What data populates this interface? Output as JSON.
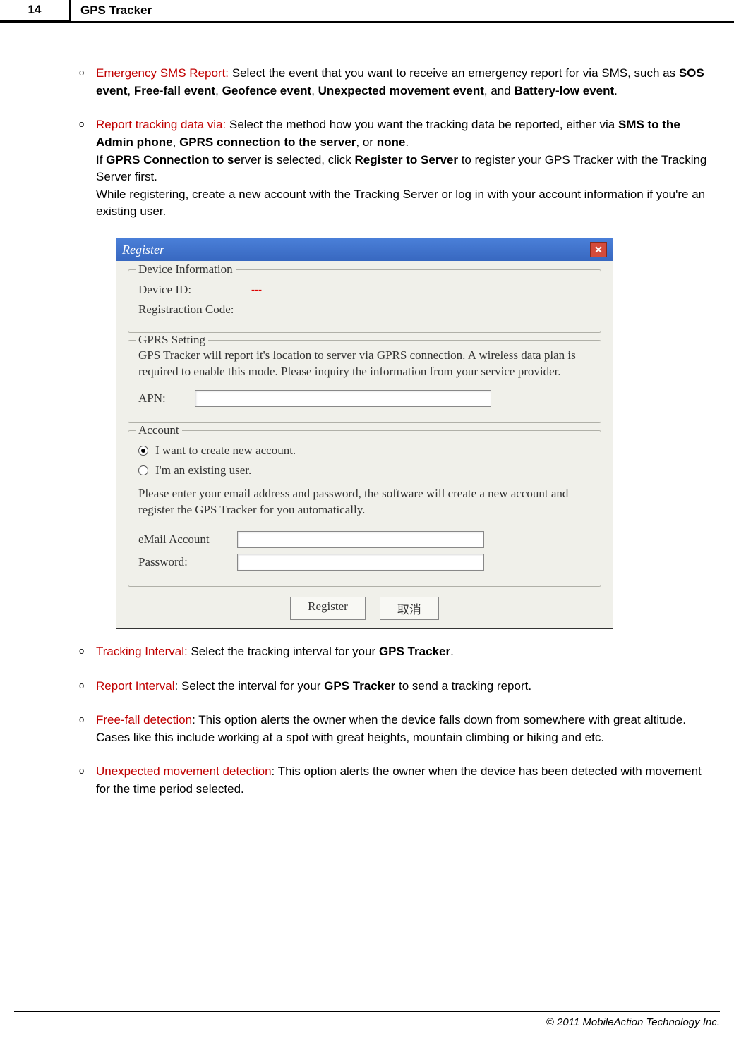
{
  "page": {
    "number": "14",
    "title": "GPS Tracker"
  },
  "items": [
    {
      "label": "Emergency SMS Report:",
      "pre": " Select the event that you want to receive an emergency report for via SMS, such as ",
      "bolds": [
        "SOS event",
        "Free-fall event",
        "Geofence event",
        "Unexpected movement event"
      ],
      "joiner": ", ",
      "post_pre": ", and ",
      "post_bold": "Battery-low event",
      "post": "."
    },
    {
      "label": "Report tracking data via:",
      "pre": " Select the method how you want the tracking data be reported, either via ",
      "b1": "SMS to the Admin phone",
      "mid1": ", ",
      "b2": "GPRS connection to the server",
      "mid2": ", or ",
      "b3": "none",
      "post1": ".",
      "line2_pre": "If ",
      "line2_b1": "GPRS Connection to se",
      "line2_mid": "rver is selected, click ",
      "line2_b2": "Register to Server",
      "line2_post": " to register your GPS Tracker with the Tracking Server first.",
      "line3": "While registering, create a new account with the Tracking Server or log in with your account information if you're an existing user."
    },
    {
      "label": "Tracking Interval:",
      "pre": " Select the tracking interval for your ",
      "b1": "GPS Tracker",
      "post": "."
    },
    {
      "label": "Report Interval",
      "pre": ": Select the interval for your ",
      "b1": "GPS Tracker",
      "post": " to send a tracking report."
    },
    {
      "label": "Free-fall detection",
      "post": ": This option alerts the owner when the device falls down from somewhere with great altitude. Cases like this include working at a spot with great heights, mountain climbing or hiking and etc."
    },
    {
      "label": "Unexpected movement detection",
      "post": ": This option alerts the owner when the device has been detected with movement for the time period selected."
    }
  ],
  "dialog": {
    "title": "Register",
    "deviceInfo": {
      "legend": "Device Information",
      "deviceIdLabel": "Device ID:",
      "deviceIdValue": "---",
      "regCodeLabel": "Registraction Code:"
    },
    "gprs": {
      "legend": "GPRS Setting",
      "desc": "GPS Tracker will report it's location to server via GPRS connection. A wireless data plan is required to enable this mode. Please inquiry the information from your service provider.",
      "apnLabel": "APN:"
    },
    "account": {
      "legend": "Account",
      "radio1": "I want to create new account.",
      "radio2": "I'm an existing user.",
      "desc": "Please enter your email address and password, the software will create a new account and register the GPS Tracker for you automatically.",
      "emailLabel": "eMail Account",
      "passwordLabel": "Password:"
    },
    "buttons": {
      "register": "Register",
      "cancel": "取消"
    }
  },
  "footer": "© 2011 MobileAction Technology Inc."
}
